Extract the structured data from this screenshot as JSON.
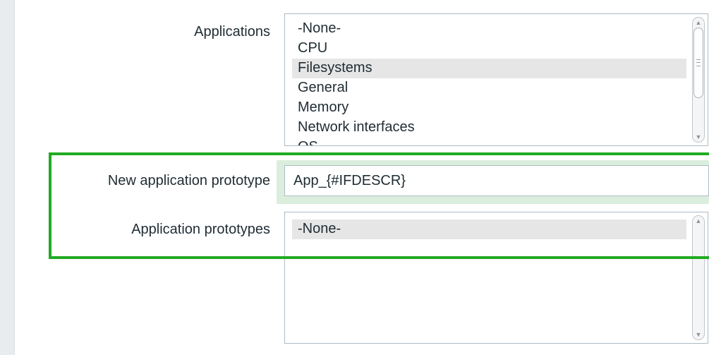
{
  "form": {
    "applications": {
      "label": "Applications",
      "options": [
        "-None-",
        "CPU",
        "Filesystems",
        "General",
        "Memory",
        "Network interfaces",
        "OS"
      ],
      "selected": "Filesystems"
    },
    "new_application_prototype": {
      "label": "New application prototype",
      "value": "App_{#IFDESCR}"
    },
    "application_prototypes": {
      "label": "Application prototypes",
      "options": [
        "-None-"
      ],
      "selected": "-None-"
    }
  },
  "colors": {
    "highlight_border": "#22aa22",
    "selected_option_bg": "#e6e6e6",
    "input_focus_glow": "#dbeedd"
  }
}
